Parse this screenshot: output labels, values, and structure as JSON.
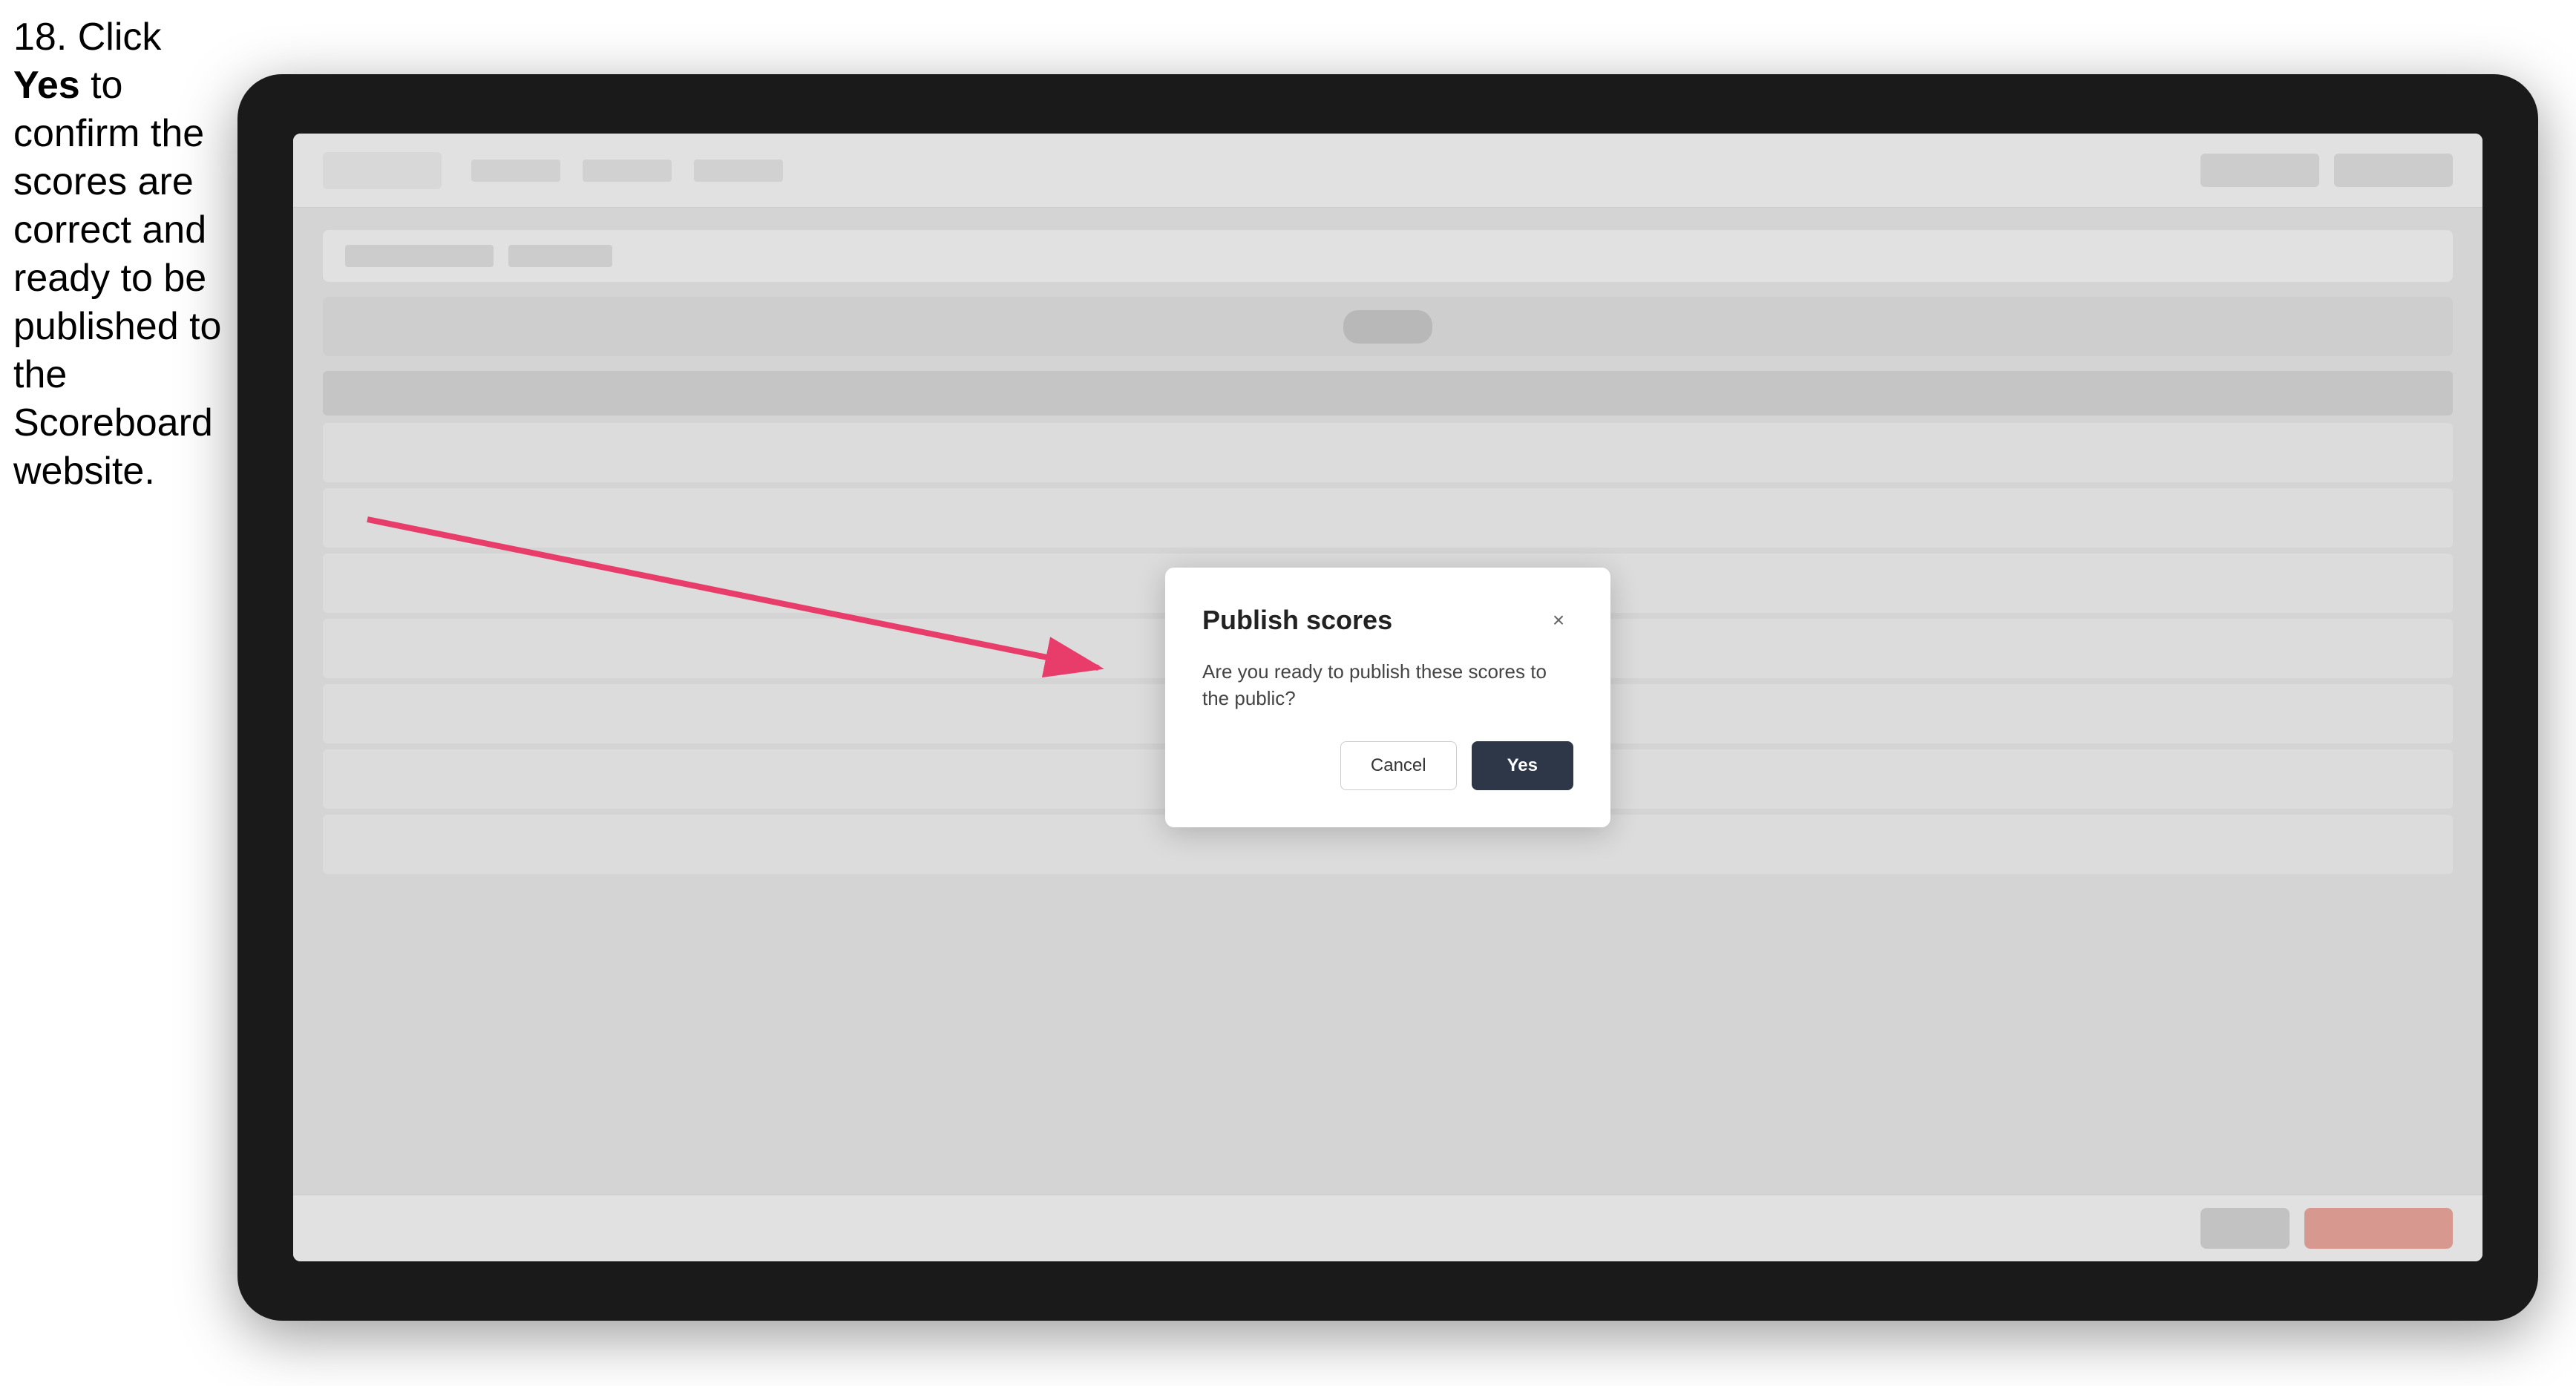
{
  "instruction": {
    "number": "18.",
    "text_before_bold": " Click ",
    "bold_text": "Yes",
    "text_after": " to confirm the scores are correct and ready to be published to the Scoreboard website."
  },
  "modal": {
    "title": "Publish scores",
    "close_icon": "×",
    "body_text": "Are you ready to publish these scores to the public?",
    "cancel_label": "Cancel",
    "yes_label": "Yes"
  },
  "app": {
    "table_rows": 7
  }
}
